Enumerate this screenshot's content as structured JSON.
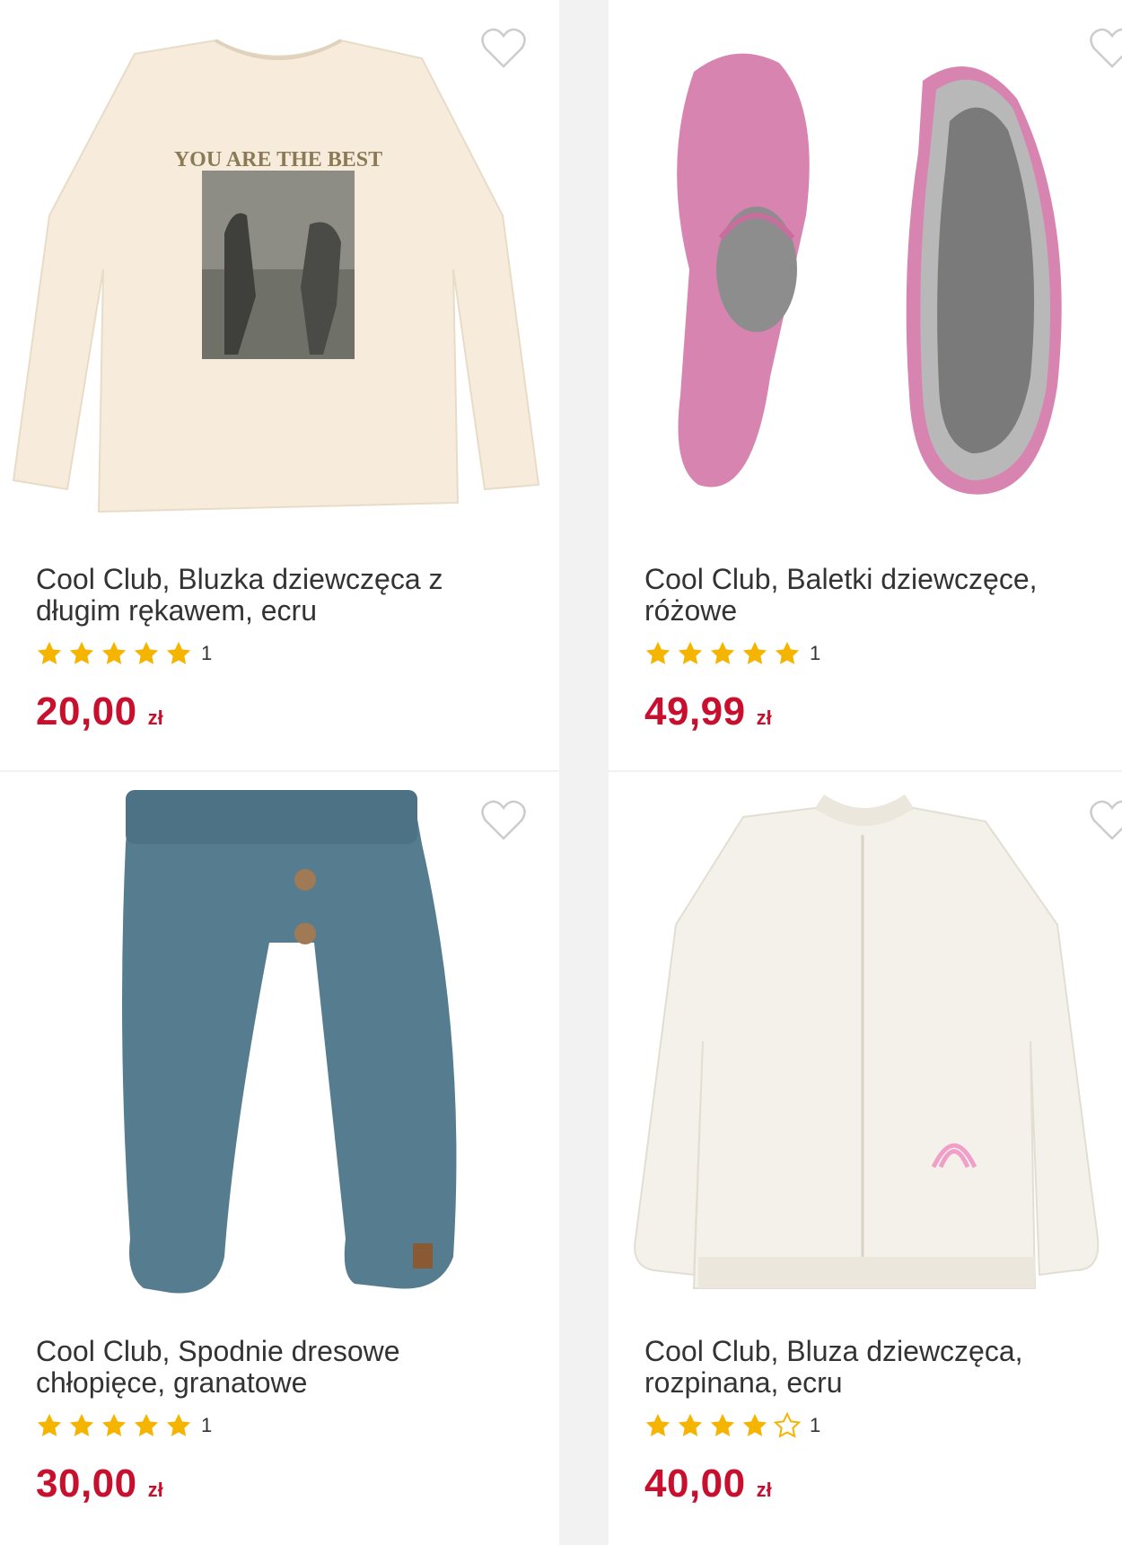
{
  "colors": {
    "price": "#c8102e",
    "star": "#f4b400",
    "heart": "#cccccc"
  },
  "products": [
    {
      "title": "Cool Club, Bluzka dziewczęca z długim rękawem, ecru",
      "title_line1": "Cool Club, Bluzka dziewczęca z",
      "title_line2": "długim rękawem, ecru",
      "rating": 5,
      "rating_count": "1",
      "price": "20,00",
      "currency": "zł",
      "image": "ecru-longsleeve-shirt-with-photo-print",
      "print_text": "YOU ARE THE BEST"
    },
    {
      "title": "Cool Club, Baletki dziewczęce, różowe",
      "title_line1": "Cool Club, Baletki dziewczęce,",
      "title_line2": "różowe",
      "rating": 5,
      "rating_count": "1",
      "price": "49,99",
      "currency": "zł",
      "image": "pink-ballet-slippers"
    },
    {
      "title": "Cool Club, Spodnie dresowe chłopięce, granatowe",
      "title_line1": "Cool Club, Spodnie dresowe",
      "title_line2": "chłopięce, granatowe",
      "rating": 5,
      "rating_count": "1",
      "price": "30,00",
      "currency": "zł",
      "image": "blue-knit-baby-trousers"
    },
    {
      "title": "Cool Club, Bluza dziewczęca, rozpinana, ecru",
      "title_line1": "Cool Club, Bluza dziewczęca,",
      "title_line2": "rozpinana, ecru",
      "rating": 4,
      "rating_count": "1",
      "price": "40,00",
      "currency": "zł",
      "image": "ecru-fleece-zip-jacket"
    }
  ]
}
